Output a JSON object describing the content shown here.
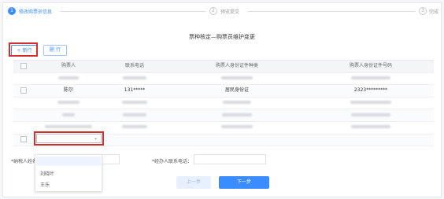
{
  "steps": [
    {
      "num": "1",
      "label": "修改购票员信息"
    },
    {
      "num": "2",
      "label": "预览提交"
    },
    {
      "num": "3",
      "label": "完成"
    }
  ],
  "form_title": "票种核定—购票员维护变更",
  "toolbar": {
    "add_label": "+ 新行",
    "delete_label": "删 行"
  },
  "table": {
    "headers": [
      "购票人",
      "联系电话",
      "购票人身份证件种类",
      "购票人身份证件号码"
    ],
    "rows": [
      {
        "name": "",
        "phone": "",
        "id_type": "",
        "id_no": ""
      },
      {
        "name": "陈尔",
        "phone": "131*****",
        "id_type": "居民身份证",
        "id_no": "2323*********"
      },
      {
        "name": "",
        "phone": "",
        "id_type": "",
        "id_no": ""
      },
      {
        "name": "",
        "phone": "",
        "id_type": "",
        "id_no": ""
      },
      {
        "name": "",
        "phone": "",
        "id_type": "",
        "id_no": ""
      }
    ]
  },
  "select": {
    "value": "",
    "caret": "⌄"
  },
  "bottom": {
    "tax_person_label": "*纳税人姓名",
    "agent_phone_label": "*经办人联系电话："
  },
  "dropdown": {
    "items": [
      "刘晓叶",
      "王乐"
    ]
  },
  "buttons": {
    "prev": "上一步",
    "next": "下一步"
  },
  "colors": {
    "accent": "#3b8cff",
    "highlight": "#d42d2d"
  }
}
